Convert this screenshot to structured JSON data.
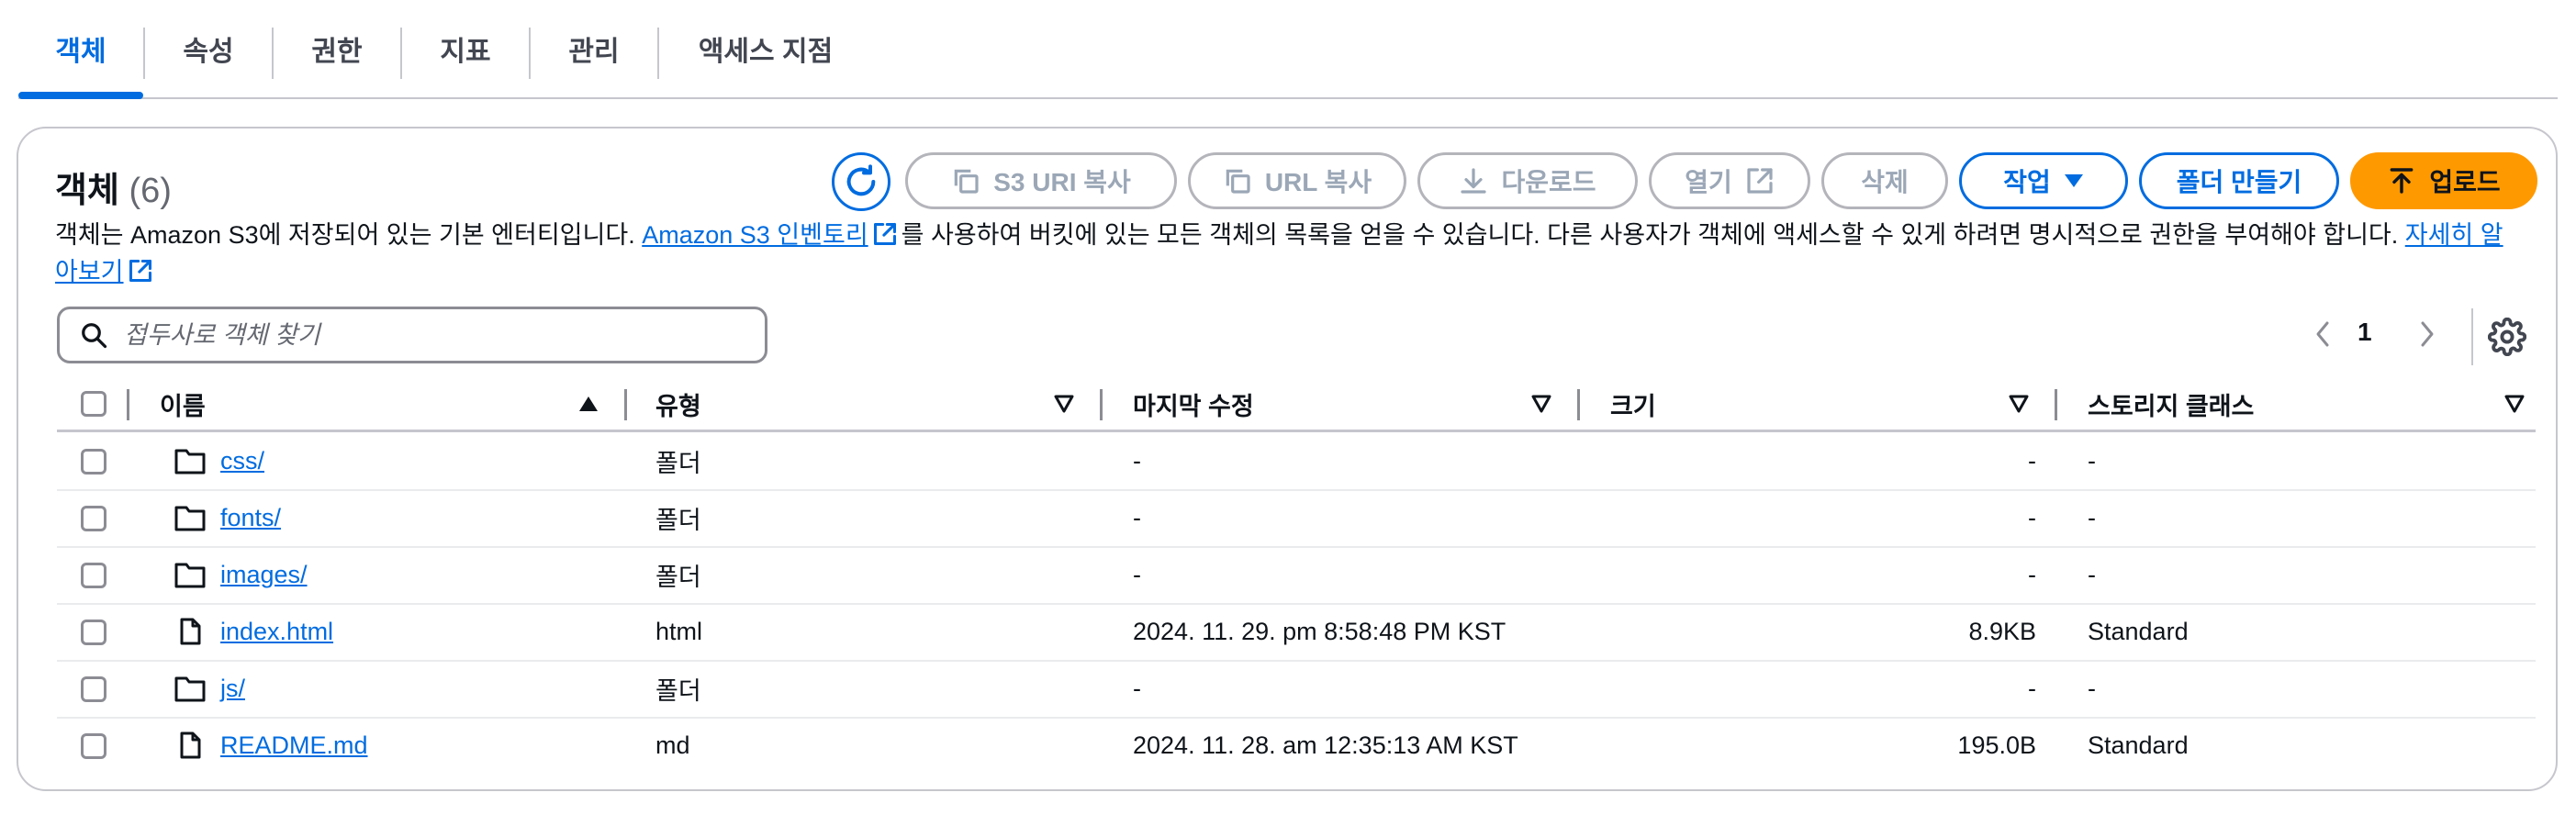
{
  "tabs": [
    "객체",
    "속성",
    "권한",
    "지표",
    "관리",
    "액세스 지점"
  ],
  "panel": {
    "title": "객체",
    "count": "(6)",
    "buttons": {
      "copy_s3_uri": "S3 URI 복사",
      "copy_url": "URL 복사",
      "download": "다운로드",
      "open": "열기",
      "delete": "삭제",
      "actions": "작업",
      "create_folder": "폴더 만들기",
      "upload": "업로드"
    },
    "description": {
      "before_link": "객체는 Amazon S3에 저장되어 있는 기본 엔터티입니다. ",
      "inventory_link": "Amazon S3 인벤토리",
      "after_link": "를 사용하여 버킷에 있는 모든 객체의 목록을 얻을 수 있습니다. 다른 사용자가 객체에 액세스할 수 있게 하려면 명시적으로 권한을 부여해야 합니다. ",
      "learn_more_link": "자세히 알아보기"
    },
    "search": {
      "placeholder": "접두사로 객체 찾기",
      "value": ""
    },
    "pagination": {
      "current_page": "1"
    }
  },
  "table": {
    "columns": [
      "이름",
      "유형",
      "마지막 수정",
      "크기",
      "스토리지 클래스"
    ],
    "rows": [
      {
        "icon": "folder-icon",
        "name": "css/",
        "type": "폴더",
        "modified": "-",
        "size": "-",
        "storage_class": "-"
      },
      {
        "icon": "folder-icon",
        "name": "fonts/",
        "type": "폴더",
        "modified": "-",
        "size": "-",
        "storage_class": "-"
      },
      {
        "icon": "folder-icon",
        "name": "images/",
        "type": "폴더",
        "modified": "-",
        "size": "-",
        "storage_class": "-"
      },
      {
        "icon": "file-icon",
        "name": "index.html",
        "type": "html",
        "modified": "2024. 11. 29. pm 8:58:48 PM KST",
        "size": "8.9KB",
        "storage_class": "Standard"
      },
      {
        "icon": "folder-icon",
        "name": "js/",
        "type": "폴더",
        "modified": "-",
        "size": "-",
        "storage_class": "-"
      },
      {
        "icon": "file-icon",
        "name": "README.md",
        "type": "md",
        "modified": "2024. 11. 28. am 12:35:13 AM KST",
        "size": "195.0B",
        "storage_class": "Standard"
      }
    ]
  },
  "colors": {
    "accent": "#006ce0",
    "primary_button": "#ff9900",
    "text": "#0f141a",
    "border": "#c6c6cd",
    "disabled": "#9ba7b6"
  }
}
